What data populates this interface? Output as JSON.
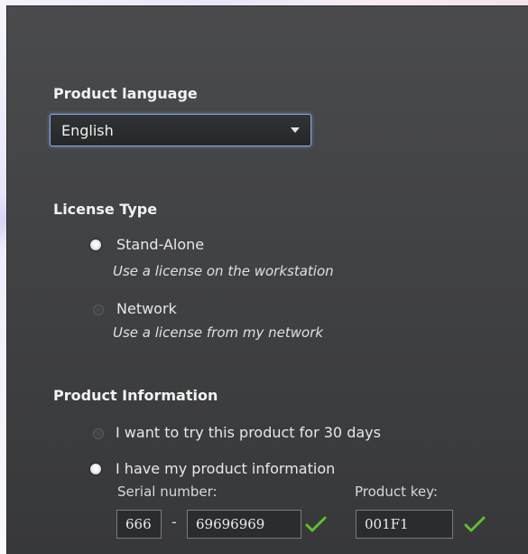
{
  "language": {
    "label": "Product language",
    "selected": "English"
  },
  "license": {
    "label": "License Type",
    "options": [
      {
        "title": "Stand-Alone",
        "description": "Use a license on the workstation",
        "selected": true
      },
      {
        "title": "Network",
        "description": "Use a license from my network",
        "selected": false
      }
    ]
  },
  "product_info": {
    "label": "Product Information",
    "trial_option": {
      "label": "I want to try this product for 30 days",
      "selected": false
    },
    "have_info_option": {
      "label": "I have my product information",
      "selected": true
    },
    "serial": {
      "label": "Serial number:",
      "prefix": "666",
      "separator": "-",
      "number": "69696969",
      "valid": true
    },
    "product_key": {
      "label": "Product key:",
      "value": "001F1",
      "valid": true
    }
  },
  "icons": {
    "dropdown": "chevron-down-icon",
    "valid": "checkmark-icon"
  },
  "colors": {
    "focus_border": "#8da9d6",
    "valid_check": "#5fbf2f"
  }
}
